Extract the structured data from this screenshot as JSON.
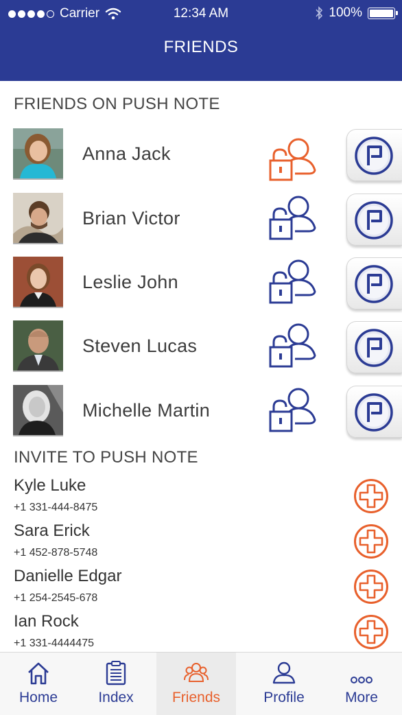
{
  "status_bar": {
    "carrier": "Carrier",
    "time": "12:34 AM",
    "battery": "100%",
    "signal_bars_filled": 4,
    "signal_bars_total": 5
  },
  "nav": {
    "title": "FRIENDS"
  },
  "friends_section": {
    "title": "FRIENDS ON PUSH NOTE",
    "items": [
      {
        "name": "Anna Jack",
        "lock_color": "#e8602c"
      },
      {
        "name": "Brian Victor",
        "lock_color": "#2b3b94"
      },
      {
        "name": "Leslie John",
        "lock_color": "#2b3b94"
      },
      {
        "name": "Steven Lucas",
        "lock_color": "#2b3b94"
      },
      {
        "name": "Michelle Martin",
        "lock_color": "#2b3b94"
      }
    ]
  },
  "invite_section": {
    "title": "INVITE TO PUSH NOTE",
    "items": [
      {
        "name": "Kyle Luke",
        "phone": "+1 331-444-8475"
      },
      {
        "name": "Sara Erick",
        "phone": "+1 452-878-5748"
      },
      {
        "name": "Danielle Edgar",
        "phone": "+1 254-2545-678"
      },
      {
        "name": "Ian Rock",
        "phone": "+1 331-4444475"
      }
    ]
  },
  "tabbar": {
    "active": "Friends",
    "tabs": [
      {
        "label": "Home",
        "icon": "home-icon"
      },
      {
        "label": "Index",
        "icon": "index-icon"
      },
      {
        "label": "Friends",
        "icon": "friends-icon"
      },
      {
        "label": "Profile",
        "icon": "profile-icon"
      },
      {
        "label": "More",
        "icon": "more-icon"
      }
    ]
  },
  "colors": {
    "brand_blue": "#2b3b94",
    "accent_orange": "#e8602c"
  }
}
